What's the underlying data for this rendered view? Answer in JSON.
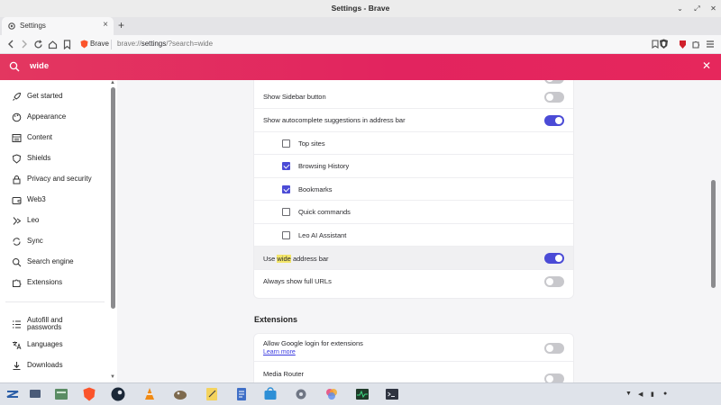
{
  "window": {
    "title": "Settings - Brave"
  },
  "tab": {
    "title": "Settings"
  },
  "toolbar": {
    "site_label": "Brave",
    "url_scheme": "brave://",
    "url_host": "settings",
    "url_path": "/?search=wide"
  },
  "search": {
    "value": "wide"
  },
  "sidebar": {
    "items": [
      {
        "label": "Get started",
        "icon": "rocket-icon"
      },
      {
        "label": "Appearance",
        "icon": "palette-icon"
      },
      {
        "label": "Content",
        "icon": "content-icon"
      },
      {
        "label": "Shields",
        "icon": "shield-icon"
      },
      {
        "label": "Privacy and security",
        "icon": "lock-icon"
      },
      {
        "label": "Web3",
        "icon": "wallet-icon"
      },
      {
        "label": "Leo",
        "icon": "leo-icon"
      },
      {
        "label": "Sync",
        "icon": "sync-icon"
      },
      {
        "label": "Search engine",
        "icon": "search-icon"
      },
      {
        "label": "Extensions",
        "icon": "puzzle-icon"
      },
      {
        "label": "Autofill and passwords",
        "icon": "list-icon"
      },
      {
        "label": "Languages",
        "icon": "language-icon"
      },
      {
        "label": "Downloads",
        "icon": "download-icon"
      }
    ]
  },
  "settings": {
    "show_sidebar_button": "Show Sidebar button",
    "show_autocomplete": "Show autocomplete suggestions in address bar",
    "top_sites": "Top sites",
    "browsing_history": "Browsing History",
    "bookmarks": "Bookmarks",
    "quick_commands": "Quick commands",
    "leo_ai": "Leo AI Assistant",
    "use_prefix": "Use ",
    "use_highlight": "wide",
    "use_suffix": " address bar",
    "always_show_full_urls": "Always show full URLs"
  },
  "extensions": {
    "heading": "Extensions",
    "google_login": "Allow Google login for extensions",
    "learn_more": "Learn more",
    "media_router": "Media Router"
  },
  "states": {
    "show_sidebar_button": false,
    "show_autocomplete": true,
    "top_sites": false,
    "browsing_history": true,
    "bookmarks": true,
    "quick_commands": false,
    "leo_ai": false,
    "wide_address_bar": true,
    "always_show_full_urls": false,
    "google_login": false
  },
  "colors": {
    "accent": "#4b4bd6",
    "search_bar": "#e2245f",
    "highlight": "#f3e66b"
  },
  "taskbar": {
    "apps": [
      "zorin-menu-icon",
      "workspace-icon",
      "files-icon",
      "brave-icon",
      "steam-icon",
      "vlc-icon",
      "gimp-icon",
      "notes-icon",
      "document-icon",
      "store-icon",
      "settings-gear-icon",
      "photos-icon",
      "system-monitor-icon",
      "terminal-icon"
    ],
    "tray": [
      "wifi-icon",
      "volume-icon",
      "battery-icon",
      "network-icon"
    ]
  }
}
